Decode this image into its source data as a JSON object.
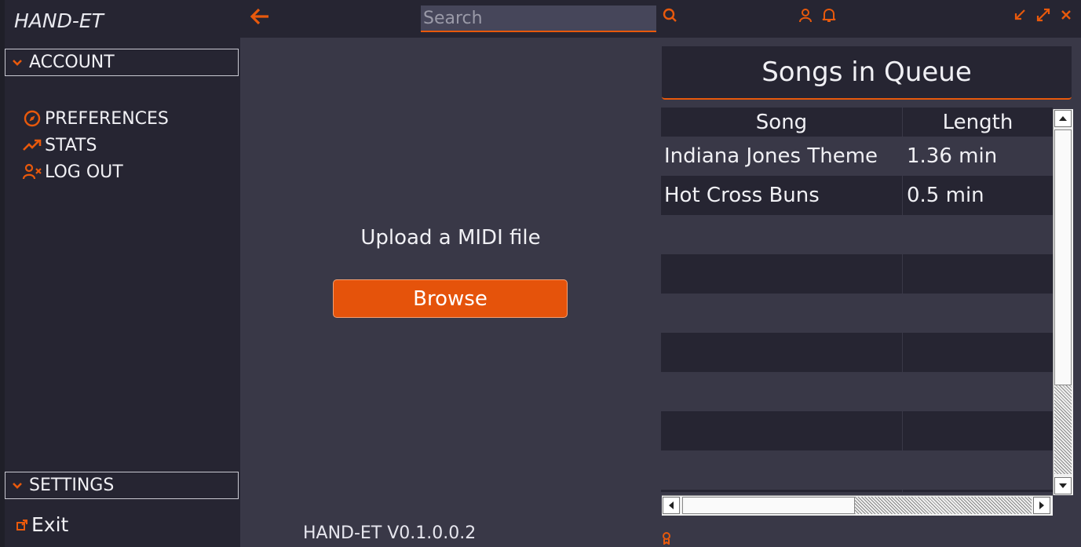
{
  "app": {
    "title": "HAND-ET",
    "version": "HAND-ET V0.1.0.0.2"
  },
  "colors": {
    "accent": "#e8590c",
    "sidebar_bg": "#262532",
    "main_bg": "#393847"
  },
  "sidebar": {
    "account_label": "ACCOUNT",
    "items": [
      {
        "label": "PREFERENCES",
        "icon": "compass-icon"
      },
      {
        "label": "STATS",
        "icon": "trending-up-icon"
      },
      {
        "label": "LOG OUT",
        "icon": "user-x-icon"
      }
    ],
    "settings_label": "SETTINGS",
    "exit_label": "Exit"
  },
  "topbar": {
    "search_placeholder": "Search"
  },
  "center": {
    "upload_label": "Upload a MIDI file",
    "browse_label": "Browse"
  },
  "queue": {
    "title": "Songs in Queue",
    "columns": [
      "Song",
      "Length"
    ],
    "rows": [
      {
        "song": "Indiana Jones Theme",
        "length": "1.36 min"
      },
      {
        "song": "Hot Cross Buns",
        "length": "0.5 min"
      }
    ]
  }
}
